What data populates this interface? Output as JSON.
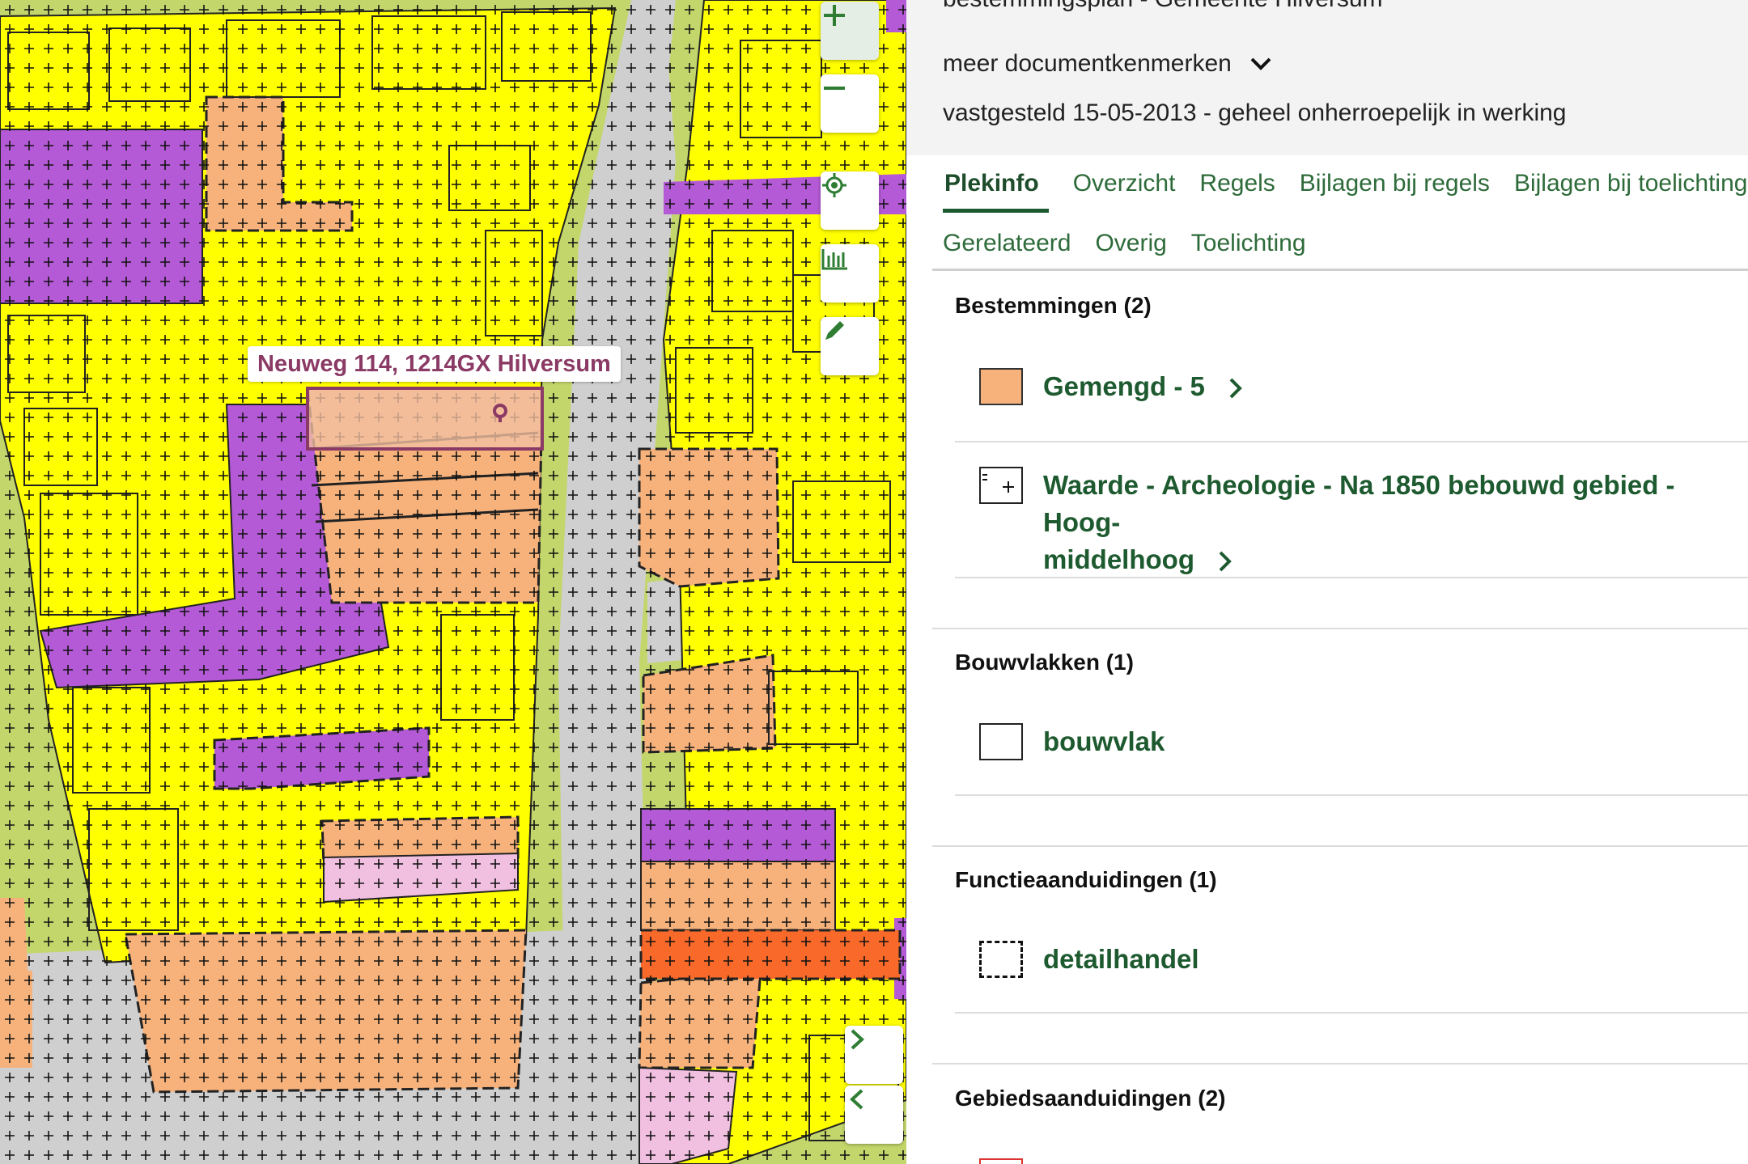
{
  "map": {
    "address_label": "Neuweg 114, 1214GX Hilversum",
    "controls": {
      "zoom_in": "zoom-in-icon",
      "zoom_out": "zoom-out-icon",
      "locate": "locate-icon",
      "legend": "legend-icon",
      "draw": "pencil-icon",
      "expand_panel": "chevron-right-icon",
      "collapse_panel": "chevron-left-icon"
    },
    "colors": {
      "wonen": "#ffff00",
      "gemengd": "#f7b27c",
      "bedrijf": "#b45ad6",
      "groen": "#c3d66b",
      "verkeer": "#cfcfcf",
      "detailhandel_zone": "#f8692a",
      "maatschappelijk": "#f1bfe0",
      "selection": "#8a3a64"
    }
  },
  "panel": {
    "doc_title": "bestemmingsplan - Gemeente Hilversum",
    "meer_label": "meer documentkenmerken",
    "status": "vastgesteld 15-05-2013 - geheel onherroepelijk in werking",
    "tabs_row1": [
      "Plekinfo",
      "Overzicht",
      "Regels",
      "Bijlagen bij regels",
      "Bijlagen bij toelichting"
    ],
    "tabs_row2": [
      "Gerelateerd",
      "Overig",
      "Toelichting"
    ],
    "active_tab": "Plekinfo",
    "sections": {
      "bestemmingen": {
        "title": "Bestemmingen (2)",
        "items": [
          {
            "label": "Gemengd - 5",
            "swatch_color": "#f7b27c"
          },
          {
            "label_line1": "Waarde - Archeologie - Na 1850 bebouwd gebied - Hoog-",
            "label_line2": "middelhoog"
          }
        ]
      },
      "bouwvlakken": {
        "title": "Bouwvlakken (1)",
        "items": [
          {
            "label": "bouwvlak"
          }
        ]
      },
      "functieaanduidingen": {
        "title": "Functieaanduidingen (1)",
        "items": [
          {
            "label": "detailhandel"
          }
        ]
      },
      "gebiedsaanduidingen": {
        "title": "Gebiedsaanduidingen (2)"
      }
    }
  }
}
